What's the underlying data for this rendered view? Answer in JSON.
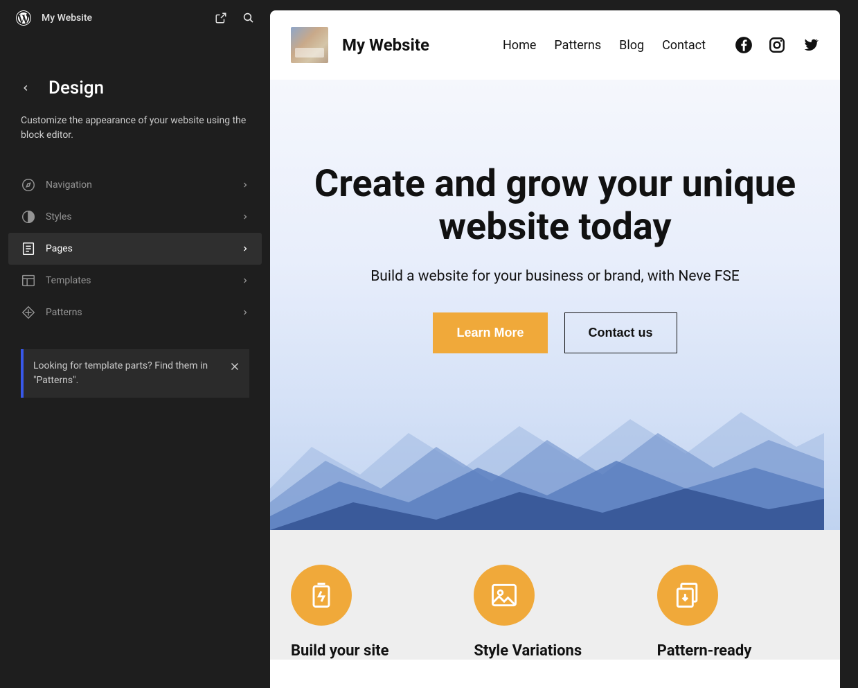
{
  "sidebar": {
    "site_name": "My Website",
    "section_title": "Design",
    "section_desc": "Customize the appearance of your website using the block editor.",
    "menu": [
      {
        "label": "Navigation",
        "active": false
      },
      {
        "label": "Styles",
        "active": false
      },
      {
        "label": "Pages",
        "active": true
      },
      {
        "label": "Templates",
        "active": false
      },
      {
        "label": "Patterns",
        "active": false
      }
    ],
    "notice": "Looking for template parts? Find them in \"Patterns\"."
  },
  "preview": {
    "site_title": "My Website",
    "nav": [
      "Home",
      "Patterns",
      "Blog",
      "Contact"
    ],
    "hero": {
      "heading": "Create and grow your unique website today",
      "sub": "Build a website for your business or brand, with Neve FSE",
      "primary_btn": "Learn More",
      "secondary_btn": "Contact us"
    },
    "features": [
      {
        "title": "Build your site"
      },
      {
        "title": "Style Variations"
      },
      {
        "title": "Pattern-ready"
      }
    ]
  },
  "colors": {
    "accent": "#f0a93a",
    "sidebar_bg": "#1e1e1e"
  }
}
